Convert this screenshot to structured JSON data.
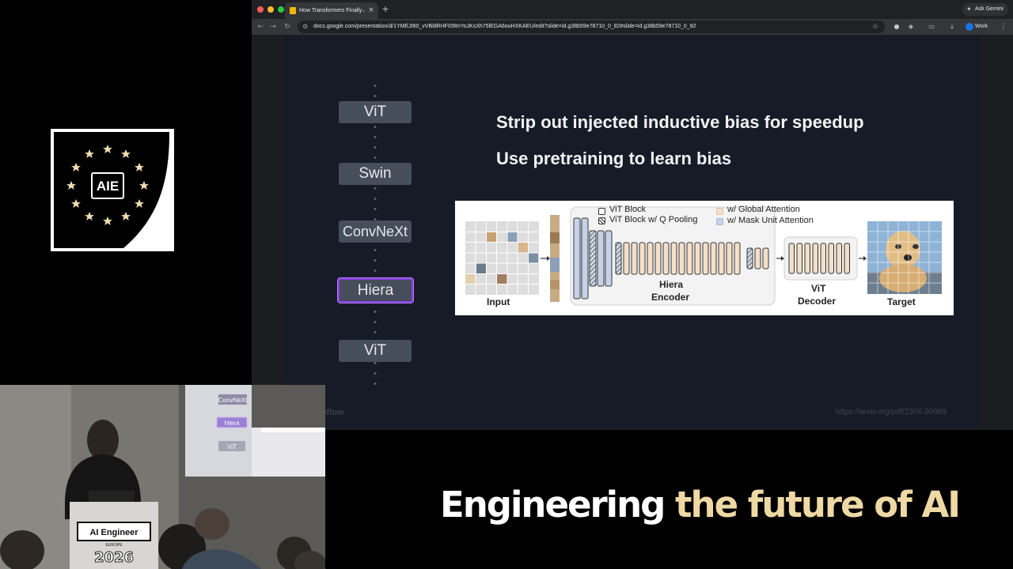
{
  "logo": {
    "text": "AIE"
  },
  "browser": {
    "tab_title": "How Transformers Finally Ate...",
    "tab_close": "×",
    "new_tab": "+",
    "ask_gemini": "Ask Gemini",
    "url": "docs.google.com/presentation/d/1YMEJI80_vVBldRHFI09InYoJKsXh75lEGA6ouHXKAEU/edit?slide=id.g38b59e78710_0_82#slide=id.g38b59e78710_0_82",
    "profile": "Work",
    "colors": {
      "close": "#ff5f57",
      "minimize": "#febc2e",
      "maximize": "#28c840"
    }
  },
  "slide": {
    "architectures": [
      "ViT",
      "Swin",
      "ConvNeXt",
      "Hiera",
      "ViT"
    ],
    "active_index": 3,
    "headlines": [
      "Strip out injected inductive bias for speedup",
      "Use pretraining to learn bias"
    ],
    "figure": {
      "legend": [
        "ViT Block",
        "ViT Block w/ Q Pooling",
        "w/ Global Attention",
        "w/ Mask Unit Attention"
      ],
      "input_label": "Input",
      "encoder_label_1": "Hiera",
      "encoder_label_2": "Encoder",
      "decoder_label_1": "ViT",
      "decoder_label_2": "Decoder",
      "target_label": "Target"
    },
    "brand": "roboflow",
    "source": "https://arxiv.org/pdf/2306.00989"
  },
  "camera": {
    "projection_items": [
      "ConvNeXt",
      "Hiera",
      "ViT"
    ],
    "podium_text": "AI Engineer",
    "podium_subtext": "EUROPE",
    "podium_year": "2026"
  },
  "tagline": {
    "part1": "Engineering",
    "part2": "the future of AI"
  },
  "colors": {
    "accent_purple": "#8b3fe8",
    "tagline_gold": "#eed9a4",
    "slide_bg": "#161b27"
  }
}
